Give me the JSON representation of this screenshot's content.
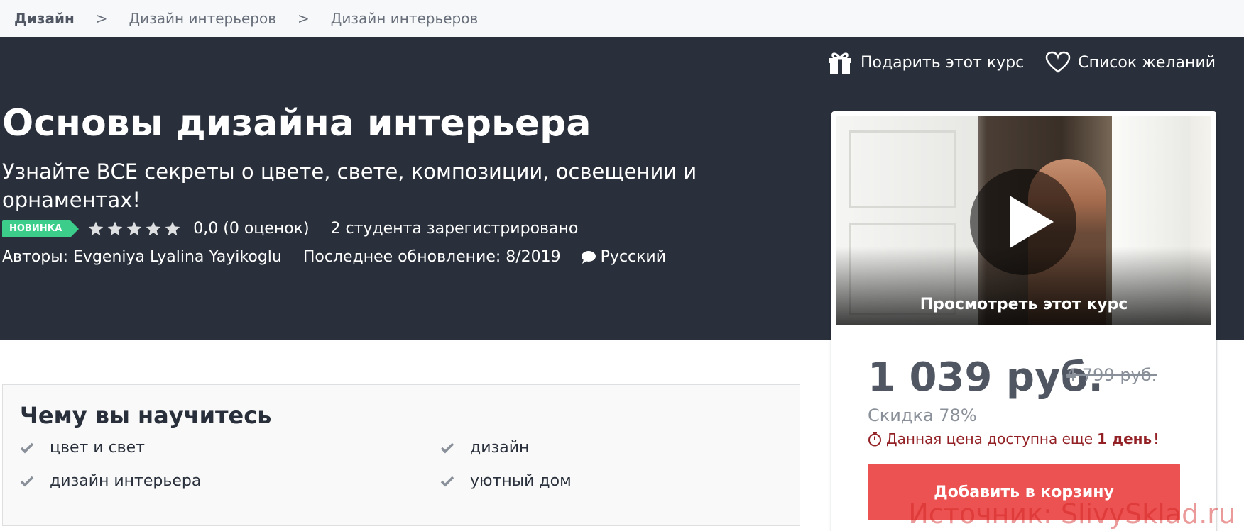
{
  "breadcrumb": [
    "Дизайн",
    "Дизайн интерьеров",
    "Дизайн интерьеров"
  ],
  "breadcrumb_separator": ">",
  "actions": {
    "gift_label": "Подарить этот курс",
    "wishlist_label": "Список желаний"
  },
  "course": {
    "title": "Основы дизайна интерьера",
    "subtitle": "Узнайте ВСЕ секреты о цвете, свете, композиции, освещении и орнаментах!",
    "badge": "НОВИНКА",
    "rating_value": 0,
    "rating_max": 5,
    "rating_text": "0,0 (0 оценок)",
    "students": "2 студента зарегистрировано",
    "authors": "Авторы: Evgeniya Lyalina Yayikoglu",
    "last_update": "Последнее обновление: 8/2019",
    "language": "Русский"
  },
  "card": {
    "preview_label": "Просмотреть этот курс",
    "price_now": "1 039 руб.",
    "price_old": "4 799 руб.",
    "discount": "Скидка 78%",
    "deadline_prefix": "Данная цена доступна еще",
    "deadline_value": "1 день",
    "deadline_suffix": "!",
    "add_to_cart": "Добавить в корзину"
  },
  "learn": {
    "title": "Чему вы научитесь",
    "items": [
      "цвет и свет",
      "дизайн",
      "дизайн интерьера",
      "уютный дом"
    ]
  },
  "watermark": "Источник: SlivySklad.ru",
  "colors": {
    "hero_bg": "#29303b",
    "badge": "#3dcd8b",
    "cart_button": "#ec5252",
    "deadline_text": "#922024"
  }
}
